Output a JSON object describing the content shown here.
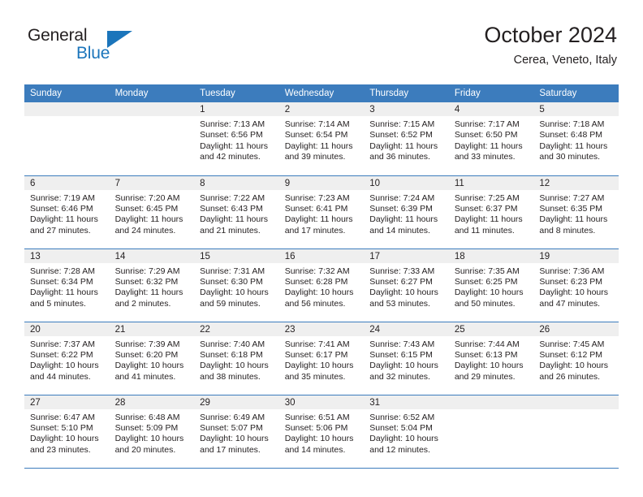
{
  "brand": {
    "name_part1": "General",
    "name_part2": "Blue",
    "triangle_color": "#1b75bb"
  },
  "header": {
    "title": "October 2024",
    "subtitle": "Cerea, Veneto, Italy"
  },
  "theme": {
    "header_blue": "#3c7cbd",
    "daynum_gray": "#efefef",
    "text": "#231f20"
  },
  "labels": {
    "sunrise_prefix": "Sunrise:",
    "sunset_prefix": "Sunset:",
    "daylight_prefix": "Daylight:"
  },
  "weekdays": [
    "Sunday",
    "Monday",
    "Tuesday",
    "Wednesday",
    "Thursday",
    "Friday",
    "Saturday"
  ],
  "weeks": [
    [
      {
        "day": "",
        "empty": true
      },
      {
        "day": "",
        "empty": true
      },
      {
        "day": "1",
        "sunrise": "Sunrise: 7:13 AM",
        "sunset": "Sunset: 6:56 PM",
        "daylight": "Daylight: 11 hours and 42 minutes."
      },
      {
        "day": "2",
        "sunrise": "Sunrise: 7:14 AM",
        "sunset": "Sunset: 6:54 PM",
        "daylight": "Daylight: 11 hours and 39 minutes."
      },
      {
        "day": "3",
        "sunrise": "Sunrise: 7:15 AM",
        "sunset": "Sunset: 6:52 PM",
        "daylight": "Daylight: 11 hours and 36 minutes."
      },
      {
        "day": "4",
        "sunrise": "Sunrise: 7:17 AM",
        "sunset": "Sunset: 6:50 PM",
        "daylight": "Daylight: 11 hours and 33 minutes."
      },
      {
        "day": "5",
        "sunrise": "Sunrise: 7:18 AM",
        "sunset": "Sunset: 6:48 PM",
        "daylight": "Daylight: 11 hours and 30 minutes."
      }
    ],
    [
      {
        "day": "6",
        "sunrise": "Sunrise: 7:19 AM",
        "sunset": "Sunset: 6:46 PM",
        "daylight": "Daylight: 11 hours and 27 minutes."
      },
      {
        "day": "7",
        "sunrise": "Sunrise: 7:20 AM",
        "sunset": "Sunset: 6:45 PM",
        "daylight": "Daylight: 11 hours and 24 minutes."
      },
      {
        "day": "8",
        "sunrise": "Sunrise: 7:22 AM",
        "sunset": "Sunset: 6:43 PM",
        "daylight": "Daylight: 11 hours and 21 minutes."
      },
      {
        "day": "9",
        "sunrise": "Sunrise: 7:23 AM",
        "sunset": "Sunset: 6:41 PM",
        "daylight": "Daylight: 11 hours and 17 minutes."
      },
      {
        "day": "10",
        "sunrise": "Sunrise: 7:24 AM",
        "sunset": "Sunset: 6:39 PM",
        "daylight": "Daylight: 11 hours and 14 minutes."
      },
      {
        "day": "11",
        "sunrise": "Sunrise: 7:25 AM",
        "sunset": "Sunset: 6:37 PM",
        "daylight": "Daylight: 11 hours and 11 minutes."
      },
      {
        "day": "12",
        "sunrise": "Sunrise: 7:27 AM",
        "sunset": "Sunset: 6:35 PM",
        "daylight": "Daylight: 11 hours and 8 minutes."
      }
    ],
    [
      {
        "day": "13",
        "sunrise": "Sunrise: 7:28 AM",
        "sunset": "Sunset: 6:34 PM",
        "daylight": "Daylight: 11 hours and 5 minutes."
      },
      {
        "day": "14",
        "sunrise": "Sunrise: 7:29 AM",
        "sunset": "Sunset: 6:32 PM",
        "daylight": "Daylight: 11 hours and 2 minutes."
      },
      {
        "day": "15",
        "sunrise": "Sunrise: 7:31 AM",
        "sunset": "Sunset: 6:30 PM",
        "daylight": "Daylight: 10 hours and 59 minutes."
      },
      {
        "day": "16",
        "sunrise": "Sunrise: 7:32 AM",
        "sunset": "Sunset: 6:28 PM",
        "daylight": "Daylight: 10 hours and 56 minutes."
      },
      {
        "day": "17",
        "sunrise": "Sunrise: 7:33 AM",
        "sunset": "Sunset: 6:27 PM",
        "daylight": "Daylight: 10 hours and 53 minutes."
      },
      {
        "day": "18",
        "sunrise": "Sunrise: 7:35 AM",
        "sunset": "Sunset: 6:25 PM",
        "daylight": "Daylight: 10 hours and 50 minutes."
      },
      {
        "day": "19",
        "sunrise": "Sunrise: 7:36 AM",
        "sunset": "Sunset: 6:23 PM",
        "daylight": "Daylight: 10 hours and 47 minutes."
      }
    ],
    [
      {
        "day": "20",
        "sunrise": "Sunrise: 7:37 AM",
        "sunset": "Sunset: 6:22 PM",
        "daylight": "Daylight: 10 hours and 44 minutes."
      },
      {
        "day": "21",
        "sunrise": "Sunrise: 7:39 AM",
        "sunset": "Sunset: 6:20 PM",
        "daylight": "Daylight: 10 hours and 41 minutes."
      },
      {
        "day": "22",
        "sunrise": "Sunrise: 7:40 AM",
        "sunset": "Sunset: 6:18 PM",
        "daylight": "Daylight: 10 hours and 38 minutes."
      },
      {
        "day": "23",
        "sunrise": "Sunrise: 7:41 AM",
        "sunset": "Sunset: 6:17 PM",
        "daylight": "Daylight: 10 hours and 35 minutes."
      },
      {
        "day": "24",
        "sunrise": "Sunrise: 7:43 AM",
        "sunset": "Sunset: 6:15 PM",
        "daylight": "Daylight: 10 hours and 32 minutes."
      },
      {
        "day": "25",
        "sunrise": "Sunrise: 7:44 AM",
        "sunset": "Sunset: 6:13 PM",
        "daylight": "Daylight: 10 hours and 29 minutes."
      },
      {
        "day": "26",
        "sunrise": "Sunrise: 7:45 AM",
        "sunset": "Sunset: 6:12 PM",
        "daylight": "Daylight: 10 hours and 26 minutes."
      }
    ],
    [
      {
        "day": "27",
        "sunrise": "Sunrise: 6:47 AM",
        "sunset": "Sunset: 5:10 PM",
        "daylight": "Daylight: 10 hours and 23 minutes."
      },
      {
        "day": "28",
        "sunrise": "Sunrise: 6:48 AM",
        "sunset": "Sunset: 5:09 PM",
        "daylight": "Daylight: 10 hours and 20 minutes."
      },
      {
        "day": "29",
        "sunrise": "Sunrise: 6:49 AM",
        "sunset": "Sunset: 5:07 PM",
        "daylight": "Daylight: 10 hours and 17 minutes."
      },
      {
        "day": "30",
        "sunrise": "Sunrise: 6:51 AM",
        "sunset": "Sunset: 5:06 PM",
        "daylight": "Daylight: 10 hours and 14 minutes."
      },
      {
        "day": "31",
        "sunrise": "Sunrise: 6:52 AM",
        "sunset": "Sunset: 5:04 PM",
        "daylight": "Daylight: 10 hours and 12 minutes."
      },
      {
        "day": "",
        "empty": true
      },
      {
        "day": "",
        "empty": true
      }
    ]
  ]
}
